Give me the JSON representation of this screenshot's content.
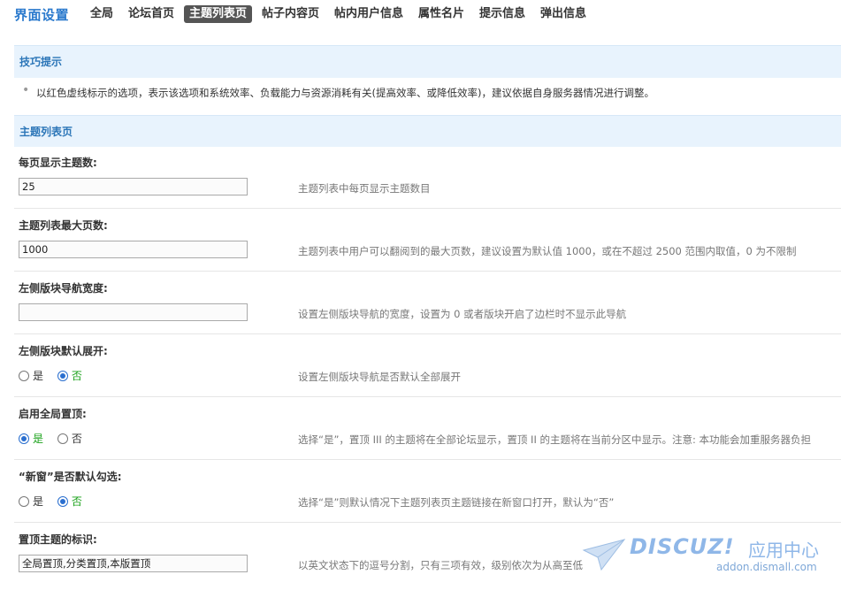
{
  "nav": {
    "brand": "界面设置",
    "items": [
      {
        "label": "全局"
      },
      {
        "label": "论坛首页"
      },
      {
        "label": "主题列表页",
        "active": true
      },
      {
        "label": "帖子内容页"
      },
      {
        "label": "帖内用户信息"
      },
      {
        "label": "属性名片"
      },
      {
        "label": "提示信息"
      },
      {
        "label": "弹出信息"
      }
    ]
  },
  "tips": {
    "title": "技巧提示",
    "text": "以红色虚线标示的选项，表示该选项和系统效率、负载能力与资源消耗有关(提高效率、或降低效率)，建议依据自身服务器情况进行调整。"
  },
  "section": {
    "title": "主题列表页"
  },
  "settings": [
    {
      "label": "每页显示主题数:",
      "type": "text",
      "value": "25",
      "desc": "主题列表中每页显示主题数目"
    },
    {
      "label": "主题列表最大页数:",
      "type": "text",
      "value": "1000",
      "desc": "主题列表中用户可以翻阅到的最大页数，建议设置为默认值 1000，或在不超过 2500 范围内取值，0 为不限制"
    },
    {
      "label": "左侧版块导航宽度:",
      "type": "text",
      "value": "",
      "desc": "设置左侧版块导航的宽度，设置为 0 或者版块开启了边栏时不显示此导航"
    },
    {
      "label": "左侧版块默认展开:",
      "type": "radio",
      "yes": "是",
      "no": "否",
      "selected": "no",
      "desc": "设置左侧版块导航是否默认全部展开"
    },
    {
      "label": "启用全局置顶:",
      "type": "radio",
      "yes": "是",
      "no": "否",
      "selected": "yes",
      "desc": "选择“是”，置顶 III 的主题将在全部论坛显示，置顶 II 的主题将在当前分区中显示。注意: 本功能会加重服务器负担"
    },
    {
      "label": "“新窗”是否默认勾选:",
      "type": "radio",
      "yes": "是",
      "no": "否",
      "selected": "no",
      "desc": "选择“是”则默认情况下主题列表页主题链接在新窗口打开，默认为“否”"
    },
    {
      "label": "置顶主题的标识:",
      "type": "text",
      "value": "全局置顶,分类置顶,本版置顶",
      "desc": "以英文状态下的逗号分割，只有三项有效，级别依次为从高至低"
    }
  ],
  "watermark": {
    "logo": "DISCUZ!",
    "cn": "应用中心",
    "url": "addon.dismall.com"
  }
}
